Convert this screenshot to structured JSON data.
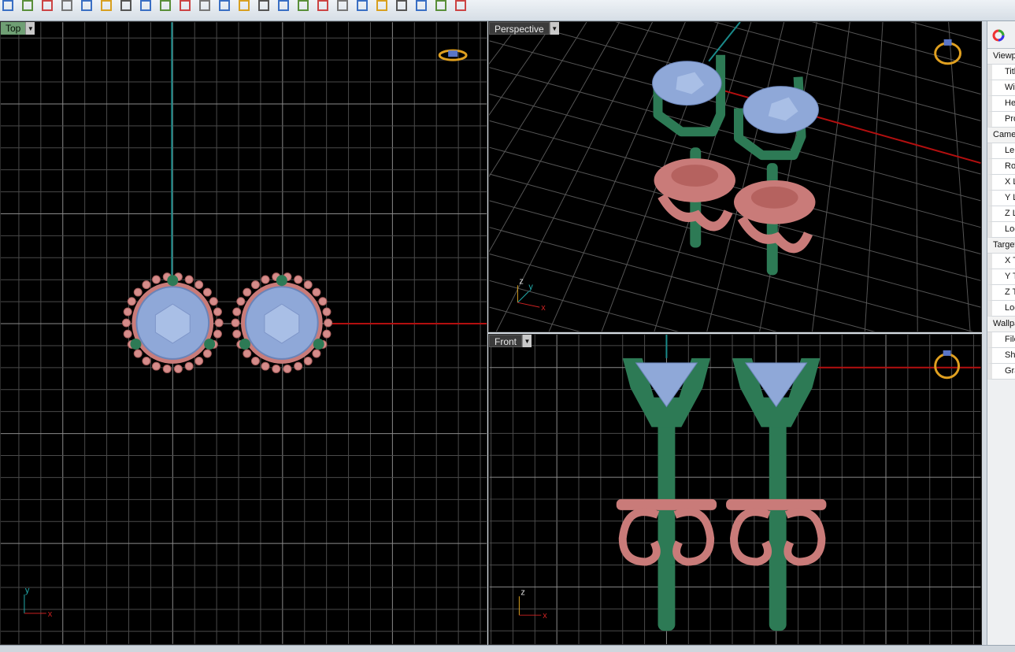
{
  "toolbar": {
    "icons": [
      "undo-icon",
      "redo-icon",
      "pan-icon",
      "select-icon",
      "move-icon",
      "copy-icon",
      "rotate-icon",
      "curve-icon",
      "line-icon",
      "polyline-icon",
      "arc-icon",
      "rectangle-icon",
      "grid-icon",
      "snap-icon",
      "point-icon",
      "scale-icon",
      "trim-icon",
      "split-icon",
      "join-icon",
      "mirror-icon",
      "array-icon",
      "boolean-icon",
      "render-icon",
      "shade-icon"
    ]
  },
  "viewports": {
    "top": {
      "label": "Top",
      "active": true,
      "axis_x": "x",
      "axis_y": "y"
    },
    "perspective": {
      "label": "Perspective",
      "active": false,
      "axis_x": "x",
      "axis_y": "y",
      "axis_z": "z"
    },
    "front": {
      "label": "Front",
      "active": false,
      "axis_x": "x",
      "axis_z": "z"
    }
  },
  "properties_panel": {
    "tab_icon": "color-wheel-icon",
    "rows": [
      {
        "type": "cat",
        "label": "Viewport"
      },
      {
        "type": "prop",
        "label": "Title"
      },
      {
        "type": "prop",
        "label": "Width"
      },
      {
        "type": "prop",
        "label": "Height"
      },
      {
        "type": "prop",
        "label": "Projection"
      },
      {
        "type": "cat",
        "label": "Camera"
      },
      {
        "type": "prop",
        "label": "Lens Length"
      },
      {
        "type": "prop",
        "label": "Rotation"
      },
      {
        "type": "prop",
        "label": "X Location"
      },
      {
        "type": "prop",
        "label": "Y Location"
      },
      {
        "type": "prop",
        "label": "Z Location"
      },
      {
        "type": "prop",
        "label": "Location"
      },
      {
        "type": "cat",
        "label": "Target"
      },
      {
        "type": "prop",
        "label": "X Target"
      },
      {
        "type": "prop",
        "label": "Y Target"
      },
      {
        "type": "prop",
        "label": "Z Target"
      },
      {
        "type": "prop",
        "label": "Location"
      },
      {
        "type": "cat",
        "label": "Wallpaper"
      },
      {
        "type": "prop",
        "label": "Filename"
      },
      {
        "type": "prop",
        "label": "Show"
      },
      {
        "type": "prop",
        "label": "Gray"
      }
    ]
  },
  "colors": {
    "grid": "#4a4a4a",
    "grid_major": "#8a8a8a",
    "x_axis": "#b30f0f",
    "y_axis": "#1a8a8a",
    "gem": "#8fa8d8",
    "metal_pink": "#c97b79",
    "prong_green": "#2d7a55",
    "active_label": "#6f9f74"
  }
}
